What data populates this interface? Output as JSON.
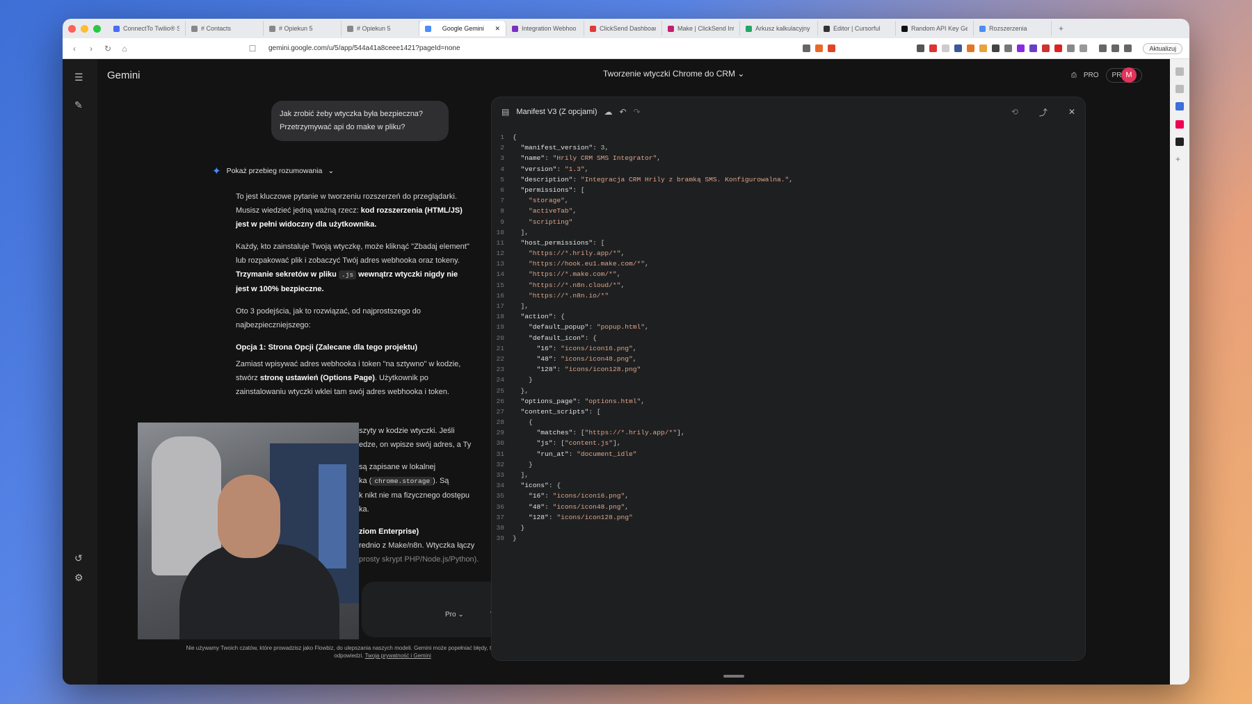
{
  "browser": {
    "tabs": [
      {
        "label": "ConnectTo Twilio® SI",
        "color": "#4a6cf7"
      },
      {
        "label": "# Contacts",
        "color": "#888"
      },
      {
        "label": "# Opiekun 5",
        "color": "#888"
      },
      {
        "label": "# Opiekun 5",
        "color": "#888"
      },
      {
        "label": "Google Gemini",
        "color": "#4c8df6",
        "active": true
      },
      {
        "label": "Integration Webhoo",
        "color": "#7b2fbf"
      },
      {
        "label": "ClickSend Dashboard",
        "color": "#e03a3a"
      },
      {
        "label": "Make | ClickSend Inte",
        "color": "#c41e6e"
      },
      {
        "label": "Arkusz kalkulacyjny",
        "color": "#22a565"
      },
      {
        "label": "Editor | Cursorful",
        "color": "#333"
      },
      {
        "label": "Random API Key Gen",
        "color": "#111"
      },
      {
        "label": "Rozszerzenia",
        "color": "#4c8df6"
      }
    ],
    "url": "gemini.google.com/u/5/app/544a41a8ceee1421?pageId=none",
    "update_label": "Aktualizuj"
  },
  "app": {
    "brand": "Gemini",
    "chat_title": "Tworzenie wtyczki Chrome do CRM",
    "pro_label": "PRO",
    "workspace_label": "PRACA",
    "avatar_letter": "M"
  },
  "chat": {
    "user_message": "Jak zrobić żeby wtyczka była bezpieczna? Przetrzymywać api do make w pliku?",
    "reasoning_toggle": "Pokaż przebieg rozumowania",
    "p1_a": "To jest kluczowe pytanie w tworzeniu rozszerzeń do przeglądarki. Musisz wiedzieć jedną ważną rzecz: ",
    "p1_b": "kod rozszerzenia (HTML/JS) jest w pełni widoczny dla użytkownika.",
    "p2_a": "Każdy, kto zainstaluje Twoją wtyczkę, może kliknąć \"Zbadaj element\" lub rozpakować plik i zobaczyć Twój adres webhooka oraz tokeny. ",
    "p2_b": "Trzymanie sekretów w pliku ",
    "p2_code": ".js",
    "p2_c": " wewnątrz wtyczki nigdy nie jest w 100% bezpieczne.",
    "p3": "Oto 3 podejścia, jak to rozwiązać, od najprostszego do najbezpieczniejszego:",
    "opt1_title": "Opcja 1: Strona Opcji (Zalecane dla tego projektu)",
    "opt1_a": "Zamiast wpisywać adres webhooka i token \"na sztywno\" w kodzie, stwórz ",
    "opt1_b": "stronę ustawień (Options Page)",
    "opt1_c": ". Użytkownik po zainstalowaniu wtyczki wklei tam swój adres webhooka i token.",
    "frag1": "szyty w kodzie wtyczki. Jeśli",
    "frag2": "edze, on wpisze swój adres, a Ty",
    "frag3": "są zapisane w lokalnej",
    "frag4_a": "ka (",
    "frag4_code": "chrome.storage",
    "frag4_b": "). Są",
    "frag5": "k nikt nie ma fizycznego dostępu",
    "frag6": "ka.",
    "frag7": "ziom Enterprise)",
    "frag8": "rednio z Make/n8n. Wtyczka łączy",
    "frag9": "prosty skrypt PHP/Node.js/Python).",
    "model_label": "Pro",
    "disclaimer_a": "Nie używamy Twoich czatów, które prowadzisz jako Flowbiz, do ulepszania naszych modeli. Gemini może popełniać błędy, także co do ludzi, dlatego sprawdzaj odpowiedzi. ",
    "disclaimer_link": "Twoja prywatność i Gemini"
  },
  "canvas": {
    "title": "Manifest V3 (Z opcjami)",
    "code": [
      "{",
      "  \"manifest_version\": 3,",
      "  \"name\": \"Hrily CRM SMS Integrator\",",
      "  \"version\": \"1.3\",",
      "  \"description\": \"Integracja CRM Hrily z bramką SMS. Konfigurowalna.\",",
      "  \"permissions\": [",
      "    \"storage\",",
      "    \"activeTab\",",
      "    \"scripting\"",
      "  ],",
      "  \"host_permissions\": [",
      "    \"https://*.hrily.app/*\",",
      "    \"https://hook.eu1.make.com/*\",",
      "    \"https://*.make.com/*\",",
      "    \"https://*.n8n.cloud/*\",",
      "    \"https://*.n8n.io/*\"",
      "  ],",
      "  \"action\": {",
      "    \"default_popup\": \"popup.html\",",
      "    \"default_icon\": {",
      "      \"16\": \"icons/icon16.png\",",
      "      \"48\": \"icons/icon48.png\",",
      "      \"128\": \"icons/icon128.png\"",
      "    }",
      "  },",
      "  \"options_page\": \"options.html\",",
      "  \"content_scripts\": [",
      "    {",
      "      \"matches\": [\"https://*.hrily.app/*\"],",
      "      \"js\": [\"content.js\"],",
      "      \"run_at\": \"document_idle\"",
      "    }",
      "  ],",
      "  \"icons\": {",
      "    \"16\": \"icons/icon16.png\",",
      "    \"48\": \"icons/icon48.png\",",
      "    \"128\": \"icons/icon128.png\"",
      "  }",
      "}"
    ]
  },
  "colors": {
    "accent_blue": "#4c8df6",
    "avatar_red": "#e0345b",
    "string_color": "#e0a58a"
  }
}
